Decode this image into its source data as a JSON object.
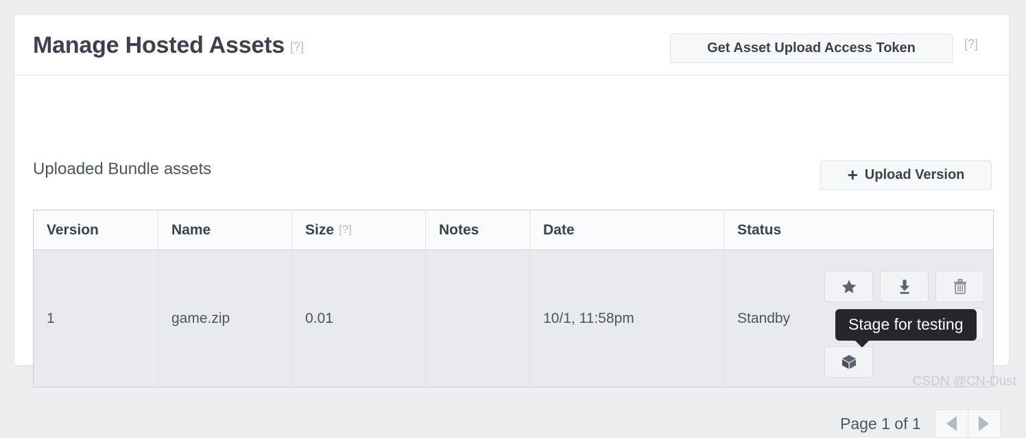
{
  "page": {
    "watermark": "CSDN @CN-Dust"
  },
  "header": {
    "title": "Manage Hosted Assets",
    "title_help": "[?]",
    "token_button": "Get Asset Upload Access Token",
    "token_help": "[?]"
  },
  "section": {
    "title": "Uploaded Bundle assets",
    "upload_button": "Upload Version",
    "upload_plus": "+"
  },
  "table": {
    "columns": [
      {
        "label": "Version",
        "help": ""
      },
      {
        "label": "Name",
        "help": ""
      },
      {
        "label": "Size",
        "help": "[?]"
      },
      {
        "label": "Notes",
        "help": ""
      },
      {
        "label": "Date",
        "help": ""
      },
      {
        "label": "Status",
        "help": ""
      }
    ],
    "rows": [
      {
        "version": "1",
        "name": "game.zip",
        "size": "0.01",
        "notes": "",
        "date": "10/1, 11:58pm",
        "status": "Standby",
        "actions": [
          {
            "name": "favorite-action",
            "icon": "star-icon"
          },
          {
            "name": "download-action",
            "icon": "download-icon"
          },
          {
            "name": "delete-action",
            "icon": "trash-icon"
          },
          {
            "name": "row2-action-1",
            "icon": "hidden-icon"
          },
          {
            "name": "row2-action-2",
            "icon": "hidden-icon"
          },
          {
            "name": "settings-action",
            "icon": "gear-icon"
          },
          {
            "name": "stage-for-testing-action",
            "icon": "cube-icon"
          }
        ]
      }
    ]
  },
  "tooltip": {
    "text": "Stage for testing"
  },
  "pagination": {
    "label": "Page 1 of 1",
    "prev_icon": "triangle-left-icon",
    "next_icon": "triangle-right-icon"
  },
  "colors": {
    "page_background": "#eceef0",
    "card_background": "#ffffff",
    "row_background": "#e8eaed",
    "text_dark": "#3c424d",
    "text_muted": "#4d545e",
    "help_gray": "#b9bec4",
    "icon_slate": "#5d6470",
    "tooltip_background": "#26272b"
  }
}
